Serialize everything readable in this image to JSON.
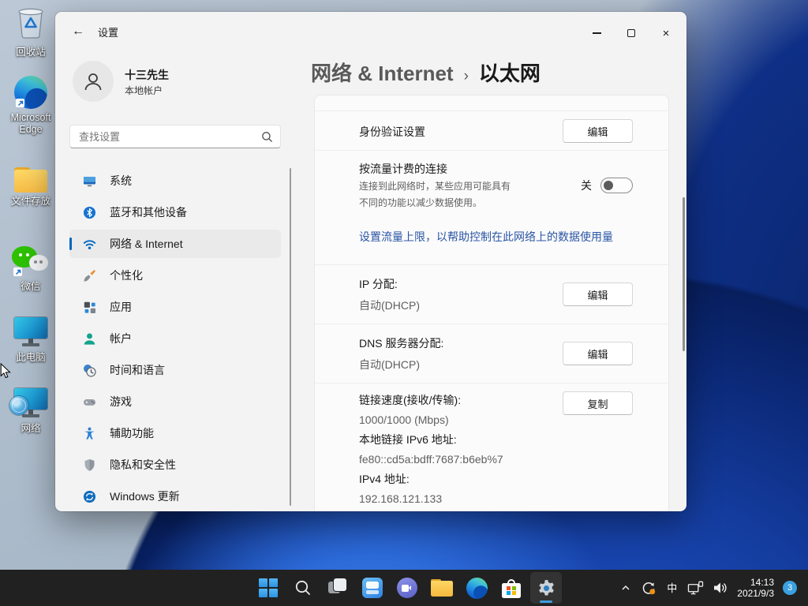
{
  "desktop": {
    "icons": [
      {
        "label": "回收站"
      },
      {
        "label": "Microsoft Edge"
      },
      {
        "label": "文件存放"
      },
      {
        "label": "微信"
      },
      {
        "label": "此电脑"
      },
      {
        "label": "网络"
      }
    ]
  },
  "window": {
    "titlebar": {
      "title": "设置",
      "back_icon": "←",
      "close_icon": "×"
    },
    "user": {
      "name": "十三先生",
      "subtitle": "本地帐户"
    },
    "search": {
      "placeholder": "查找设置"
    },
    "nav": [
      {
        "label": "系统"
      },
      {
        "label": "蓝牙和其他设备"
      },
      {
        "label": "网络 & Internet"
      },
      {
        "label": "个性化"
      },
      {
        "label": "应用"
      },
      {
        "label": "帐户"
      },
      {
        "label": "时间和语言"
      },
      {
        "label": "游戏"
      },
      {
        "label": "辅助功能"
      },
      {
        "label": "隐私和安全性"
      },
      {
        "label": "Windows 更新"
      }
    ],
    "breadcrumb": {
      "parent": "网络 & Internet",
      "sep": "›",
      "current": "以太网"
    },
    "content": {
      "auth": {
        "label": "身份验证设置",
        "button": "编辑"
      },
      "metered": {
        "title": "按流量计费的连接",
        "desc": "连接到此网络时，某些应用可能具有不同的功能以减少数据使用。",
        "toggle_state": "关",
        "link": "设置流量上限，以帮助控制在此网络上的数据使用量"
      },
      "ip": {
        "label": "IP 分配:",
        "value": "自动(DHCP)",
        "button": "编辑"
      },
      "dns": {
        "label": "DNS 服务器分配:",
        "value": "自动(DHCP)",
        "button": "编辑"
      },
      "details": {
        "button": "复制",
        "fields": [
          {
            "label": "链接速度(接收/传输):",
            "value": "1000/1000 (Mbps)"
          },
          {
            "label": "本地链接 IPv6 地址:",
            "value": "fe80::cd5a:bdff:7687:b6eb%7"
          },
          {
            "label": "IPv4 地址:",
            "value": "192.168.121.133"
          }
        ]
      }
    }
  },
  "taskbar": {
    "tray": {
      "ime": "中",
      "time": "14:13",
      "date": "2021/9/3",
      "badge": "3"
    }
  },
  "colors": {
    "accent": "#0067C0",
    "link": "#2A55A4",
    "taskbar": "#212121",
    "badge": "#3AA0E0"
  }
}
